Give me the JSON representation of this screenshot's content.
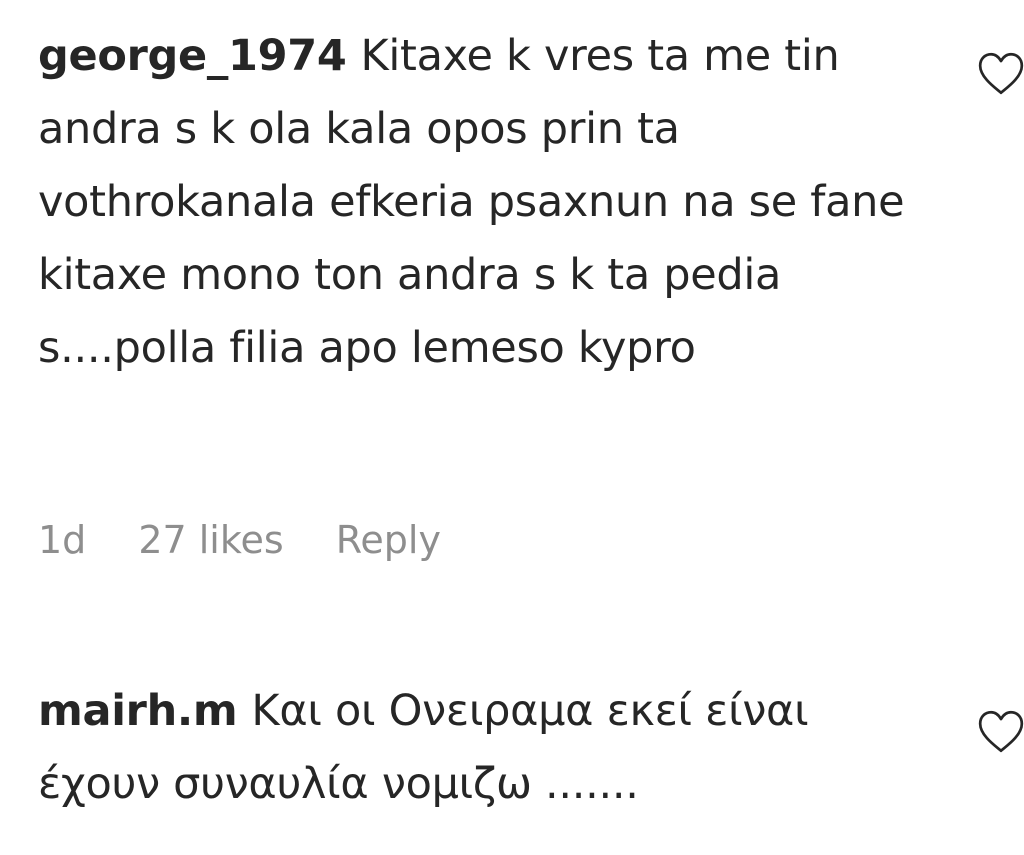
{
  "comments": [
    {
      "username": "george_1974",
      "text": "Kitaxe k vres ta me tin andra s k ola kala opos prin ta vothrokanala efkeria psaxnun na se fane kitaxe mono ton andra s k ta pedia s....polla filia apo lemeso kypro",
      "time": "1d",
      "likes": "27 likes",
      "reply_label": "Reply",
      "like_icon": "heart-outline-icon"
    },
    {
      "username": "mairh.m",
      "text": "Και οι Ονειραμα εκεί είναι έχουν συναυλία νομιζω .......",
      "like_icon": "heart-outline-icon"
    }
  ],
  "colors": {
    "text": "#262626",
    "meta": "#8e8e8e",
    "icon_stroke": "#262626",
    "background": "#ffffff"
  }
}
